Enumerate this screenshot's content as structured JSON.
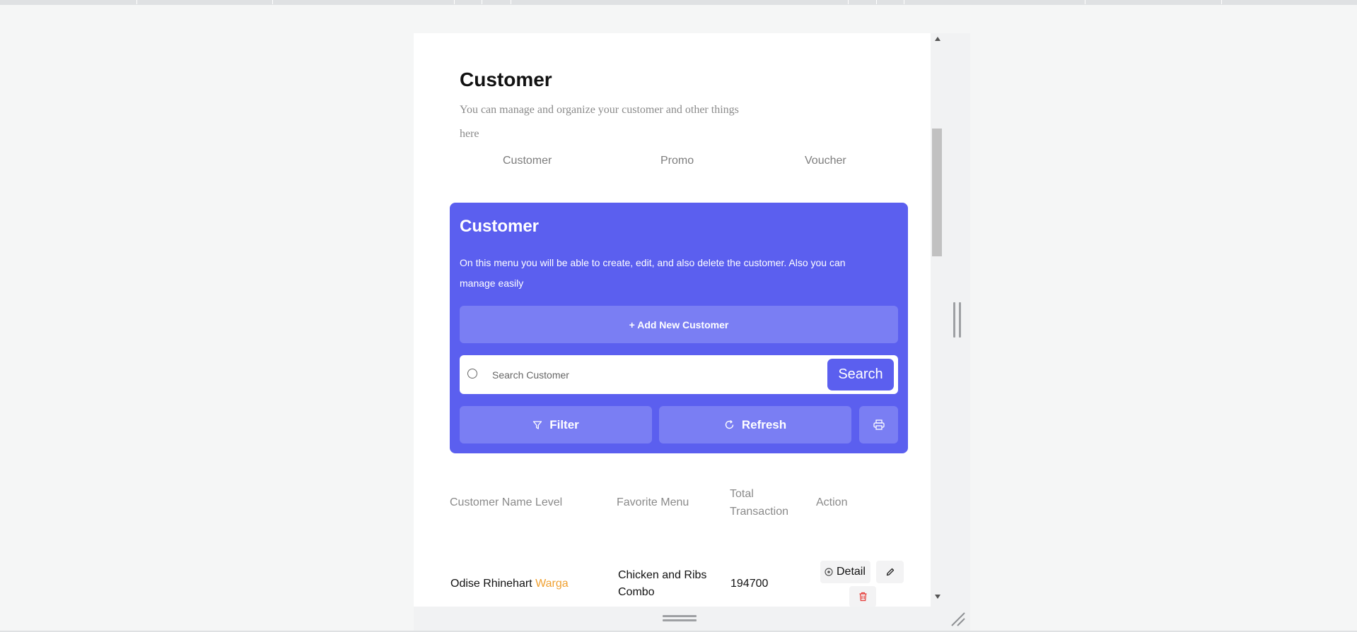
{
  "page": {
    "title": "Customer",
    "subtitle": "You can manage and organize your customer and other things here"
  },
  "tabs": [
    {
      "label": "Customer"
    },
    {
      "label": "Promo"
    },
    {
      "label": "Voucher"
    }
  ],
  "card": {
    "title": "Customer",
    "description": "On this menu you will be able to create, edit, and also delete the customer. Also you can manage easily",
    "add_label": "+ Add New Customer",
    "search_placeholder": "Search Customer",
    "search_label": "Search",
    "filter_label": "Filter",
    "refresh_label": "Refresh",
    "accent": "#5b5fef",
    "accent_light": "#7a7ef3"
  },
  "table": {
    "headers": {
      "name_level": "Customer Name Level",
      "favorite": "Favorite Menu",
      "total": "Total Transaction",
      "action": "Action"
    },
    "rows": [
      {
        "name": "Odise Rhinehart",
        "level": "Warga",
        "favorite": "Chicken and Ribs Combo",
        "total": "194700",
        "detail_label": "Detail"
      }
    ]
  },
  "icons": [
    "search-icon",
    "filter-icon",
    "refresh-icon",
    "printer-icon",
    "eye-icon",
    "pencil-icon",
    "trash-icon"
  ]
}
